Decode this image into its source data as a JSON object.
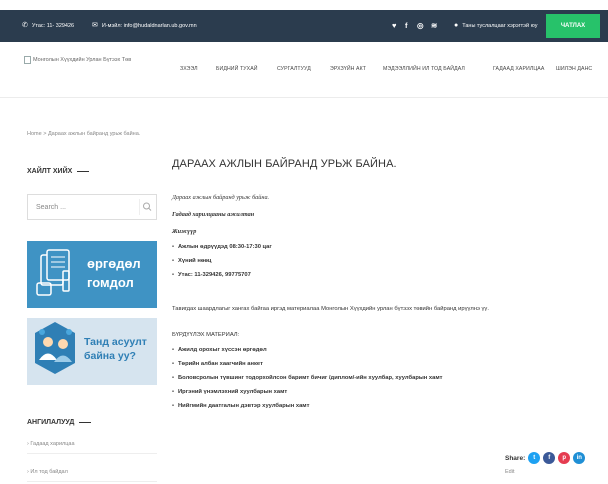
{
  "topbar": {
    "phone": "Утас: 11- 329426",
    "email": "И-мэйл: info@hudaldnarlan.ub.gov.mn",
    "feedback": "Таны туслалцааг хэрэгтэй юу",
    "donate": "ЧАТЛАХ",
    "social": [
      "twitter-icon",
      "facebook-icon",
      "instagram-icon",
      "rss-icon"
    ]
  },
  "header": {
    "logo_alt": "Монголын Хүүхдийн Урлан Бүтээх Төв",
    "nav": [
      "ЗХЭЭЛ",
      "БИДНИЙ ТУХАЙ",
      "СУРГАЛТУУД",
      "ЭРХЗҮЙН АКТ",
      "МЭДЭЭЛЛИЙН ИЛ ТОД БАЙДАЛ",
      "ГАДААД ХАРИЛЦАА",
      "ШИЛЭН ДАНС"
    ]
  },
  "breadcrumb": "Home > Дараах ажлын байранд урьж байна.",
  "sidebar": {
    "search_heading": "ХАЙЛТ ХИЙХ",
    "search_placeholder": "Search ...",
    "banner1": {
      "line1": "өргөдөл",
      "line2": "гомдол"
    },
    "banner2": {
      "line1": "Танд асуулт",
      "line2": "байна уу?"
    },
    "categories_heading": "АНГИЛАЛУУД",
    "categories": [
      "Гадаад харилцаа",
      "Ил тод байдал"
    ]
  },
  "article": {
    "title": "ДАРААХ АЖЛЫН БАЙРАНД УРЬЖ БАЙНА.",
    "intro": "Дараах ажлын байранд урьж байна.",
    "sub1": "Гадаад харилцааны ажилтан",
    "sub2": "Жижүүр",
    "details": [
      "Ажлын өдрүүдэд 08:30-17:30 цаг",
      "Хүний нөөц",
      "Утас: 11-329426, 99775707"
    ],
    "note": "Тавигдах шаардлагыг хангах байгаа иргэд материалаа Монголын Хүүхдийн урлан бүтээх төвийн байранд ирүүлнэ үү.",
    "materials_heading": "БҮРДҮҮЛЭХ МАТЕРИАЛ:",
    "materials": [
      "Ажилд орохыг хүссэн өргөдөл",
      "Төрийн албан хаагчийн анкет",
      "Боловсролын түвшинг тодорхойлсон баримт бичиг /диплом/-ийн хуулбар, хуулбарын хамт",
      "Иргэний үнэмлэхний хуулбарын хамт",
      "Нийгмийн даатгалын дэвтэр хуулбарын хамт"
    ]
  },
  "share": {
    "label": "Share:",
    "buttons": [
      "twitter-share-icon",
      "facebook-share-icon",
      "pinterest-share-icon",
      "linkedin-share-icon"
    ],
    "colors": [
      "#1da1f2",
      "#3b5998",
      "#e53b50",
      "#1f8fd5"
    ]
  },
  "edit": "Edit"
}
